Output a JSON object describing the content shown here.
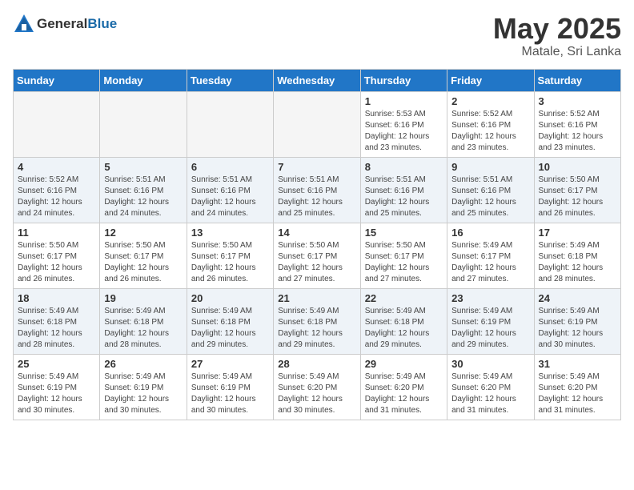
{
  "logo": {
    "text_general": "General",
    "text_blue": "Blue"
  },
  "title": {
    "month_year": "May 2025",
    "location": "Matale, Sri Lanka"
  },
  "weekdays": [
    "Sunday",
    "Monday",
    "Tuesday",
    "Wednesday",
    "Thursday",
    "Friday",
    "Saturday"
  ],
  "weeks": [
    [
      {
        "day": "",
        "info": ""
      },
      {
        "day": "",
        "info": ""
      },
      {
        "day": "",
        "info": ""
      },
      {
        "day": "",
        "info": ""
      },
      {
        "day": "1",
        "info": "Sunrise: 5:53 AM\nSunset: 6:16 PM\nDaylight: 12 hours\nand 23 minutes."
      },
      {
        "day": "2",
        "info": "Sunrise: 5:52 AM\nSunset: 6:16 PM\nDaylight: 12 hours\nand 23 minutes."
      },
      {
        "day": "3",
        "info": "Sunrise: 5:52 AM\nSunset: 6:16 PM\nDaylight: 12 hours\nand 23 minutes."
      }
    ],
    [
      {
        "day": "4",
        "info": "Sunrise: 5:52 AM\nSunset: 6:16 PM\nDaylight: 12 hours\nand 24 minutes."
      },
      {
        "day": "5",
        "info": "Sunrise: 5:51 AM\nSunset: 6:16 PM\nDaylight: 12 hours\nand 24 minutes."
      },
      {
        "day": "6",
        "info": "Sunrise: 5:51 AM\nSunset: 6:16 PM\nDaylight: 12 hours\nand 24 minutes."
      },
      {
        "day": "7",
        "info": "Sunrise: 5:51 AM\nSunset: 6:16 PM\nDaylight: 12 hours\nand 25 minutes."
      },
      {
        "day": "8",
        "info": "Sunrise: 5:51 AM\nSunset: 6:16 PM\nDaylight: 12 hours\nand 25 minutes."
      },
      {
        "day": "9",
        "info": "Sunrise: 5:51 AM\nSunset: 6:16 PM\nDaylight: 12 hours\nand 25 minutes."
      },
      {
        "day": "10",
        "info": "Sunrise: 5:50 AM\nSunset: 6:17 PM\nDaylight: 12 hours\nand 26 minutes."
      }
    ],
    [
      {
        "day": "11",
        "info": "Sunrise: 5:50 AM\nSunset: 6:17 PM\nDaylight: 12 hours\nand 26 minutes."
      },
      {
        "day": "12",
        "info": "Sunrise: 5:50 AM\nSunset: 6:17 PM\nDaylight: 12 hours\nand 26 minutes."
      },
      {
        "day": "13",
        "info": "Sunrise: 5:50 AM\nSunset: 6:17 PM\nDaylight: 12 hours\nand 26 minutes."
      },
      {
        "day": "14",
        "info": "Sunrise: 5:50 AM\nSunset: 6:17 PM\nDaylight: 12 hours\nand 27 minutes."
      },
      {
        "day": "15",
        "info": "Sunrise: 5:50 AM\nSunset: 6:17 PM\nDaylight: 12 hours\nand 27 minutes."
      },
      {
        "day": "16",
        "info": "Sunrise: 5:49 AM\nSunset: 6:17 PM\nDaylight: 12 hours\nand 27 minutes."
      },
      {
        "day": "17",
        "info": "Sunrise: 5:49 AM\nSunset: 6:18 PM\nDaylight: 12 hours\nand 28 minutes."
      }
    ],
    [
      {
        "day": "18",
        "info": "Sunrise: 5:49 AM\nSunset: 6:18 PM\nDaylight: 12 hours\nand 28 minutes."
      },
      {
        "day": "19",
        "info": "Sunrise: 5:49 AM\nSunset: 6:18 PM\nDaylight: 12 hours\nand 28 minutes."
      },
      {
        "day": "20",
        "info": "Sunrise: 5:49 AM\nSunset: 6:18 PM\nDaylight: 12 hours\nand 29 minutes."
      },
      {
        "day": "21",
        "info": "Sunrise: 5:49 AM\nSunset: 6:18 PM\nDaylight: 12 hours\nand 29 minutes."
      },
      {
        "day": "22",
        "info": "Sunrise: 5:49 AM\nSunset: 6:18 PM\nDaylight: 12 hours\nand 29 minutes."
      },
      {
        "day": "23",
        "info": "Sunrise: 5:49 AM\nSunset: 6:19 PM\nDaylight: 12 hours\nand 29 minutes."
      },
      {
        "day": "24",
        "info": "Sunrise: 5:49 AM\nSunset: 6:19 PM\nDaylight: 12 hours\nand 30 minutes."
      }
    ],
    [
      {
        "day": "25",
        "info": "Sunrise: 5:49 AM\nSunset: 6:19 PM\nDaylight: 12 hours\nand 30 minutes."
      },
      {
        "day": "26",
        "info": "Sunrise: 5:49 AM\nSunset: 6:19 PM\nDaylight: 12 hours\nand 30 minutes."
      },
      {
        "day": "27",
        "info": "Sunrise: 5:49 AM\nSunset: 6:19 PM\nDaylight: 12 hours\nand 30 minutes."
      },
      {
        "day": "28",
        "info": "Sunrise: 5:49 AM\nSunset: 6:20 PM\nDaylight: 12 hours\nand 30 minutes."
      },
      {
        "day": "29",
        "info": "Sunrise: 5:49 AM\nSunset: 6:20 PM\nDaylight: 12 hours\nand 31 minutes."
      },
      {
        "day": "30",
        "info": "Sunrise: 5:49 AM\nSunset: 6:20 PM\nDaylight: 12 hours\nand 31 minutes."
      },
      {
        "day": "31",
        "info": "Sunrise: 5:49 AM\nSunset: 6:20 PM\nDaylight: 12 hours\nand 31 minutes."
      }
    ]
  ]
}
